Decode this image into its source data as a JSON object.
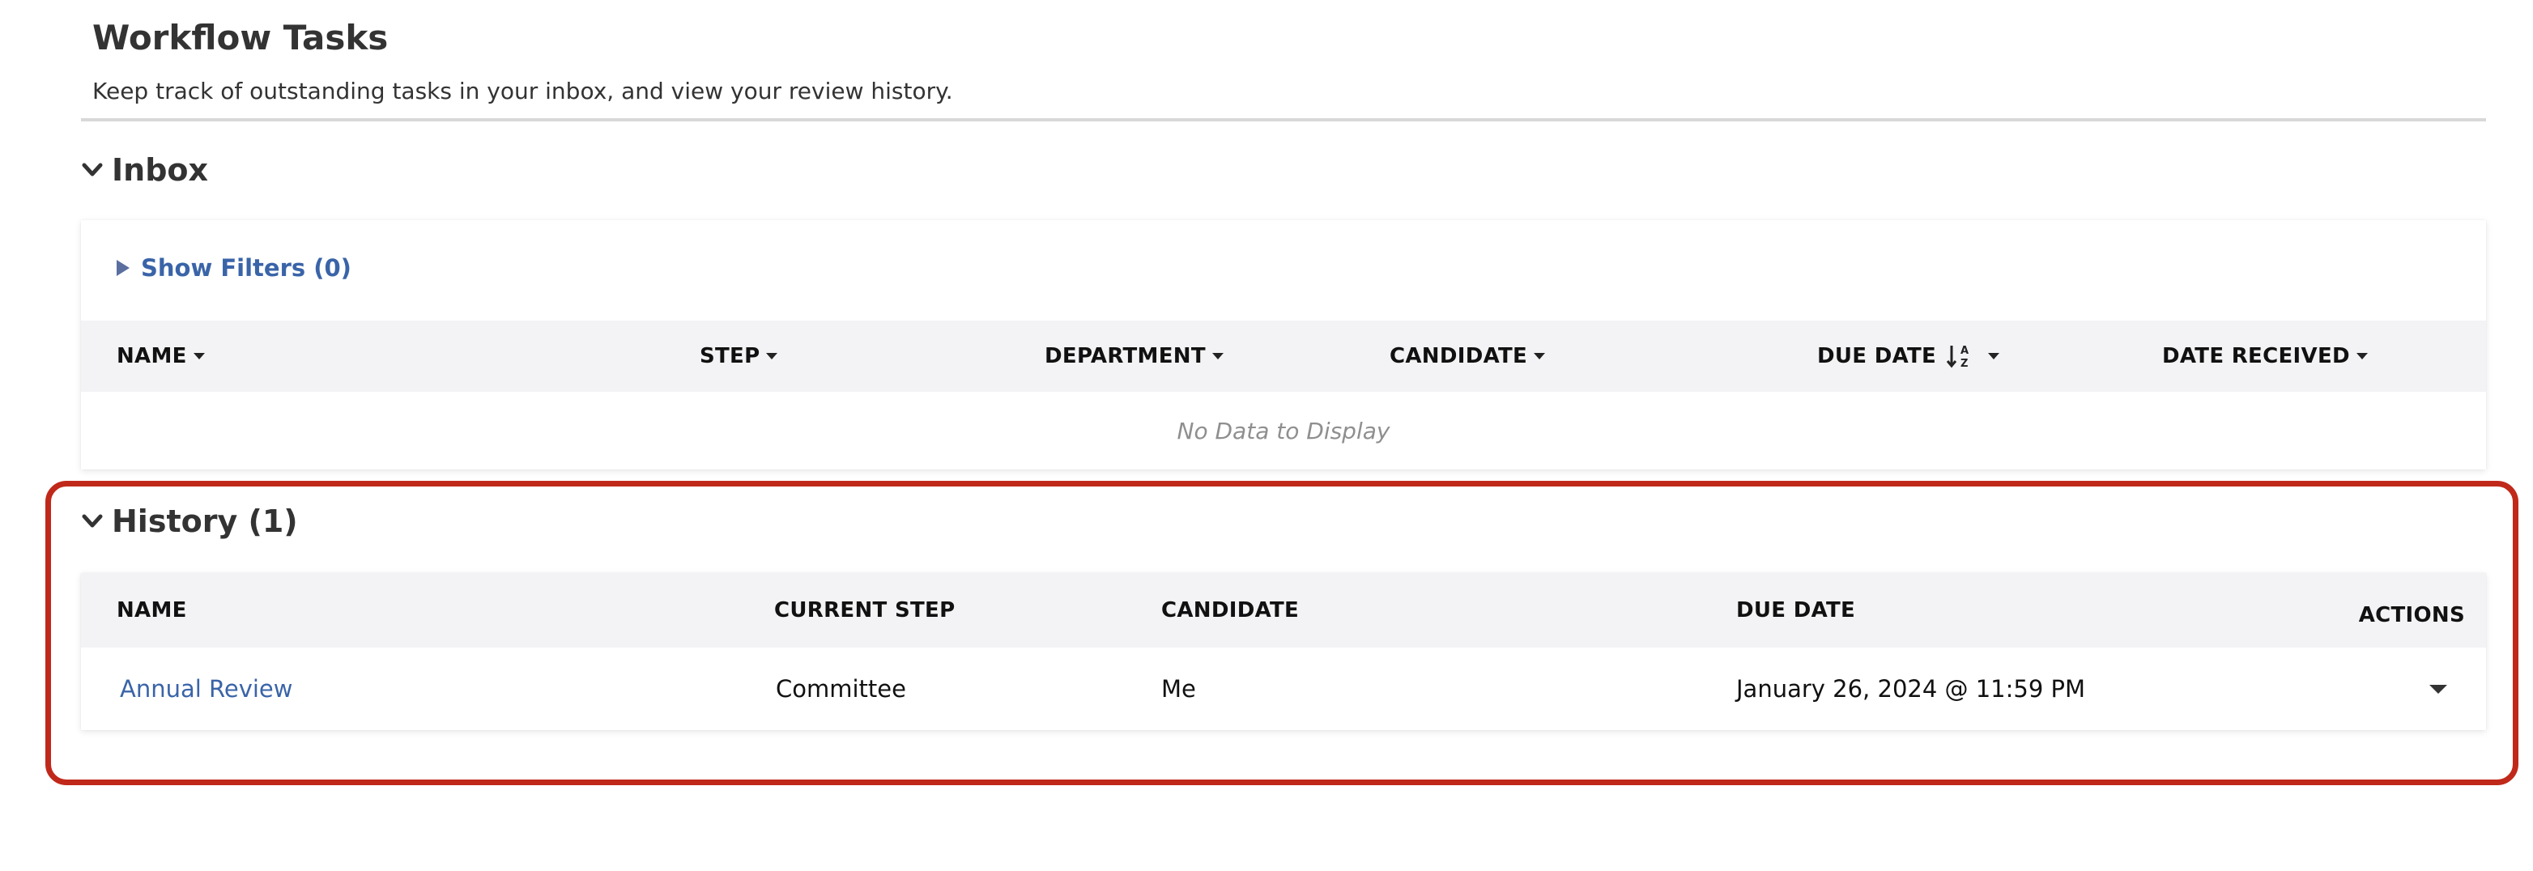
{
  "page": {
    "title": "Workflow Tasks",
    "subtitle": "Keep track of outstanding tasks in your inbox, and view your review history."
  },
  "inbox": {
    "heading": "Inbox",
    "filters_label": "Show Filters (0)",
    "columns": [
      "NAME",
      "STEP",
      "DEPARTMENT",
      "CANDIDATE",
      "DUE DATE",
      "DATE RECEIVED"
    ],
    "empty_message": "No Data to Display"
  },
  "history": {
    "heading": "History (1)",
    "columns": [
      "NAME",
      "CURRENT STEP",
      "CANDIDATE",
      "DUE DATE",
      "ACTIONS"
    ],
    "rows": [
      {
        "name": "Annual Review",
        "current_step": "Committee",
        "candidate": "Me",
        "due_date": "January 26, 2024 @ 11:59 PM"
      }
    ]
  },
  "icons": {
    "section_toggle": "chevron-down-icon",
    "filters_toggle": "triangle-right-icon",
    "sort": "sort-alpha-ascending-icon",
    "column_menu": "caret-down-icon",
    "row_actions": "caret-down-icon"
  },
  "colors": {
    "link": "#3a64a8",
    "table_header_bg": "#f3f3f5",
    "highlight_border": "#c0291a"
  }
}
